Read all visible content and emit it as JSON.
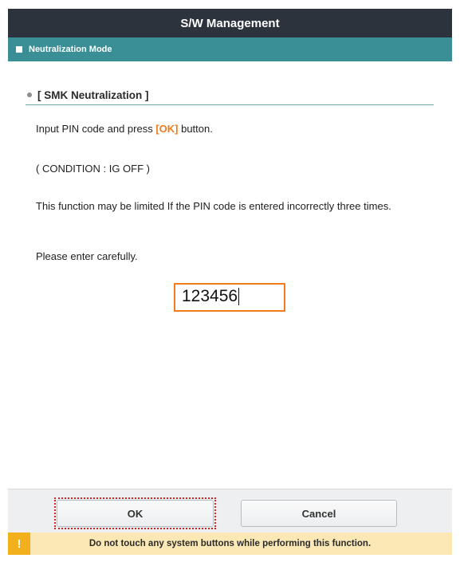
{
  "window": {
    "title": "S/W Management"
  },
  "mode_bar": {
    "label": "Neutralization Mode"
  },
  "section": {
    "title": "[ SMK Neutralization ]"
  },
  "instructions": {
    "line1_before": "Input PIN code and press ",
    "line1_highlight": "[OK]",
    "line1_after": " button.",
    "condition": "( CONDITION : IG OFF )",
    "limit_warning": "This function may be limited If the PIN code is entered incorrectly three times.",
    "careful": "Please enter carefully."
  },
  "pin_input": {
    "value": "123456"
  },
  "buttons": {
    "ok": "OK",
    "cancel": "Cancel"
  },
  "warning_bar": {
    "icon": "!",
    "message": "Do not touch any system buttons while performing this function."
  },
  "colors": {
    "titlebar": "#2c333d",
    "mode_bar": "#3a8f96",
    "highlight": "#f07b1d",
    "warning_bg": "#fbe8b5",
    "warning_icon": "#f2b11c"
  }
}
